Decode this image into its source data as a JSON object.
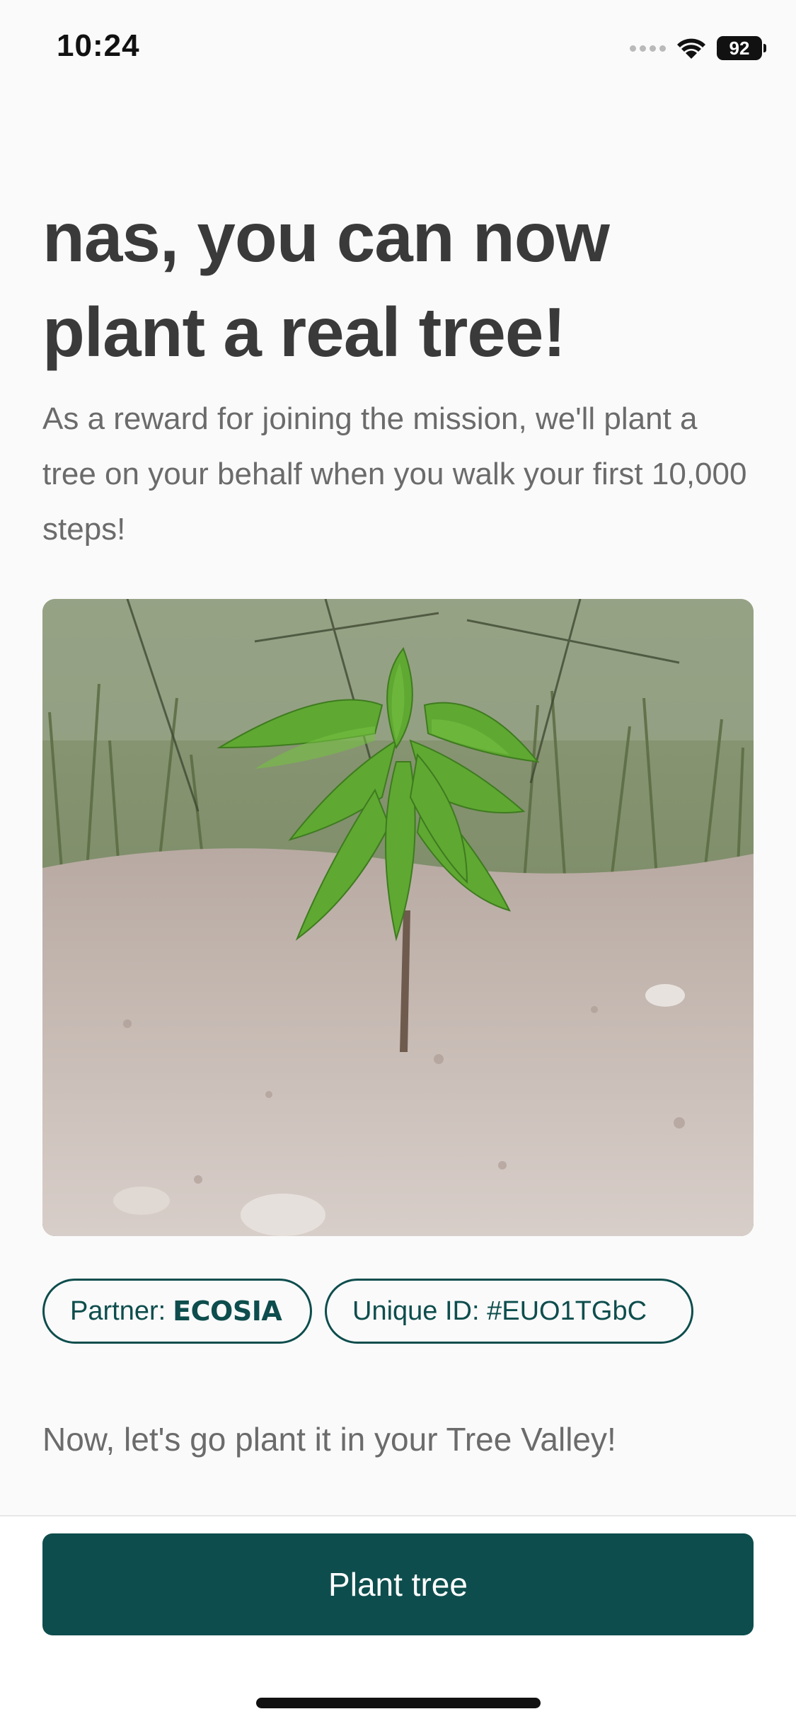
{
  "status_bar": {
    "time": "10:24",
    "battery": "92",
    "icons": [
      "cellular-signal-icon",
      "wifi-icon",
      "battery-icon"
    ]
  },
  "headline": "nas, you can now plant a real tree!",
  "subtext": "As a reward for joining the mission, we'll plant a tree on your behalf when you walk your first 10,000 steps!",
  "photo": {
    "subject": "sapling-photo"
  },
  "chips": {
    "partner_label": "Partner:",
    "partner_name": "ECOSIA",
    "unique_id": "Unique ID: #EUO1TGbC"
  },
  "cta_text": "Now, let's go plant it in your Tree Valley!",
  "plant_button": "Plant tree",
  "colors": {
    "primary": "#0e4d4d",
    "background": "#fafafa",
    "headline": "#3a3a3a",
    "body_text": "#6b6b6b"
  }
}
